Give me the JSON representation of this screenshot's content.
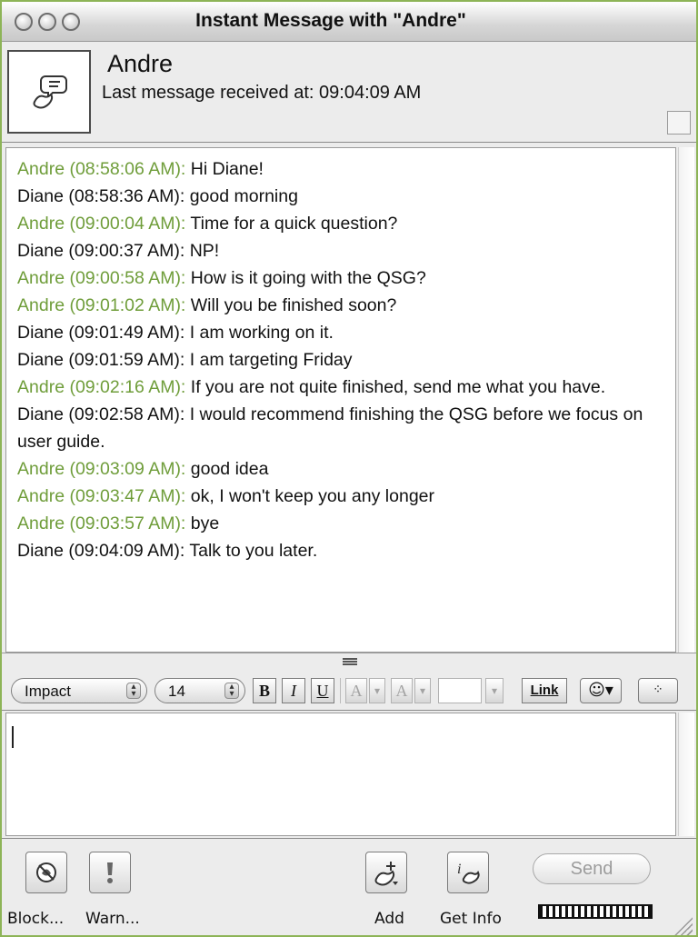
{
  "window": {
    "title": "Instant Message with \"Andre\""
  },
  "header": {
    "buddy_name": "Andre",
    "last_message": "Last message received at: 09:04:09 AM"
  },
  "transcript": [
    {
      "sender": "Andre (08:58:06 AM):",
      "text": " Hi Diane!",
      "from": "andre"
    },
    {
      "sender": "Diane (08:58:36 AM):",
      "text": " good morning",
      "from": "diane"
    },
    {
      "sender": "Andre (09:00:04 AM):",
      "text": " Time for a quick question?",
      "from": "andre"
    },
    {
      "sender": "Diane (09:00:37 AM):",
      "text": " NP!",
      "from": "diane"
    },
    {
      "sender": "Andre (09:00:58 AM):",
      "text": " How is it going with the QSG?",
      "from": "andre"
    },
    {
      "sender": "Andre (09:01:02 AM):",
      "text": " Will you be finished soon?",
      "from": "andre"
    },
    {
      "sender": "Diane (09:01:49 AM):",
      "text": " I am working on it.",
      "from": "diane"
    },
    {
      "sender": "Diane (09:01:59 AM):",
      "text": " I am targeting Friday",
      "from": "diane"
    },
    {
      "sender": "Andre (09:02:16 AM):",
      "text": " If you are not quite finished, send me what you have.",
      "from": "andre"
    },
    {
      "sender": "Diane (09:02:58 AM):",
      "text": " I would recommend finishing the QSG before we focus on user guide.",
      "from": "diane"
    },
    {
      "sender": "Andre (09:03:09 AM):",
      "text": " good idea",
      "from": "andre"
    },
    {
      "sender": "Andre (09:03:47 AM):",
      "text": " ok, I won't keep you any longer",
      "from": "andre"
    },
    {
      "sender": "Andre (09:03:57 AM):",
      "text": " bye",
      "from": "andre"
    },
    {
      "sender": "Diane (09:04:09 AM):",
      "text": " Talk to you later.",
      "from": "diane"
    }
  ],
  "toolbar": {
    "font": "Impact",
    "size": "14",
    "bold": "B",
    "italic": "I",
    "underline": "U",
    "text_color": "A",
    "back_color": "A",
    "link": "Link"
  },
  "buttons": {
    "block": "Block...",
    "warn": "Warn...",
    "add": "Add",
    "get_info": "Get Info",
    "send": "Send"
  },
  "colors": {
    "andre": "#6f9d3a",
    "diane": "#111111",
    "frame": "#8db457"
  }
}
